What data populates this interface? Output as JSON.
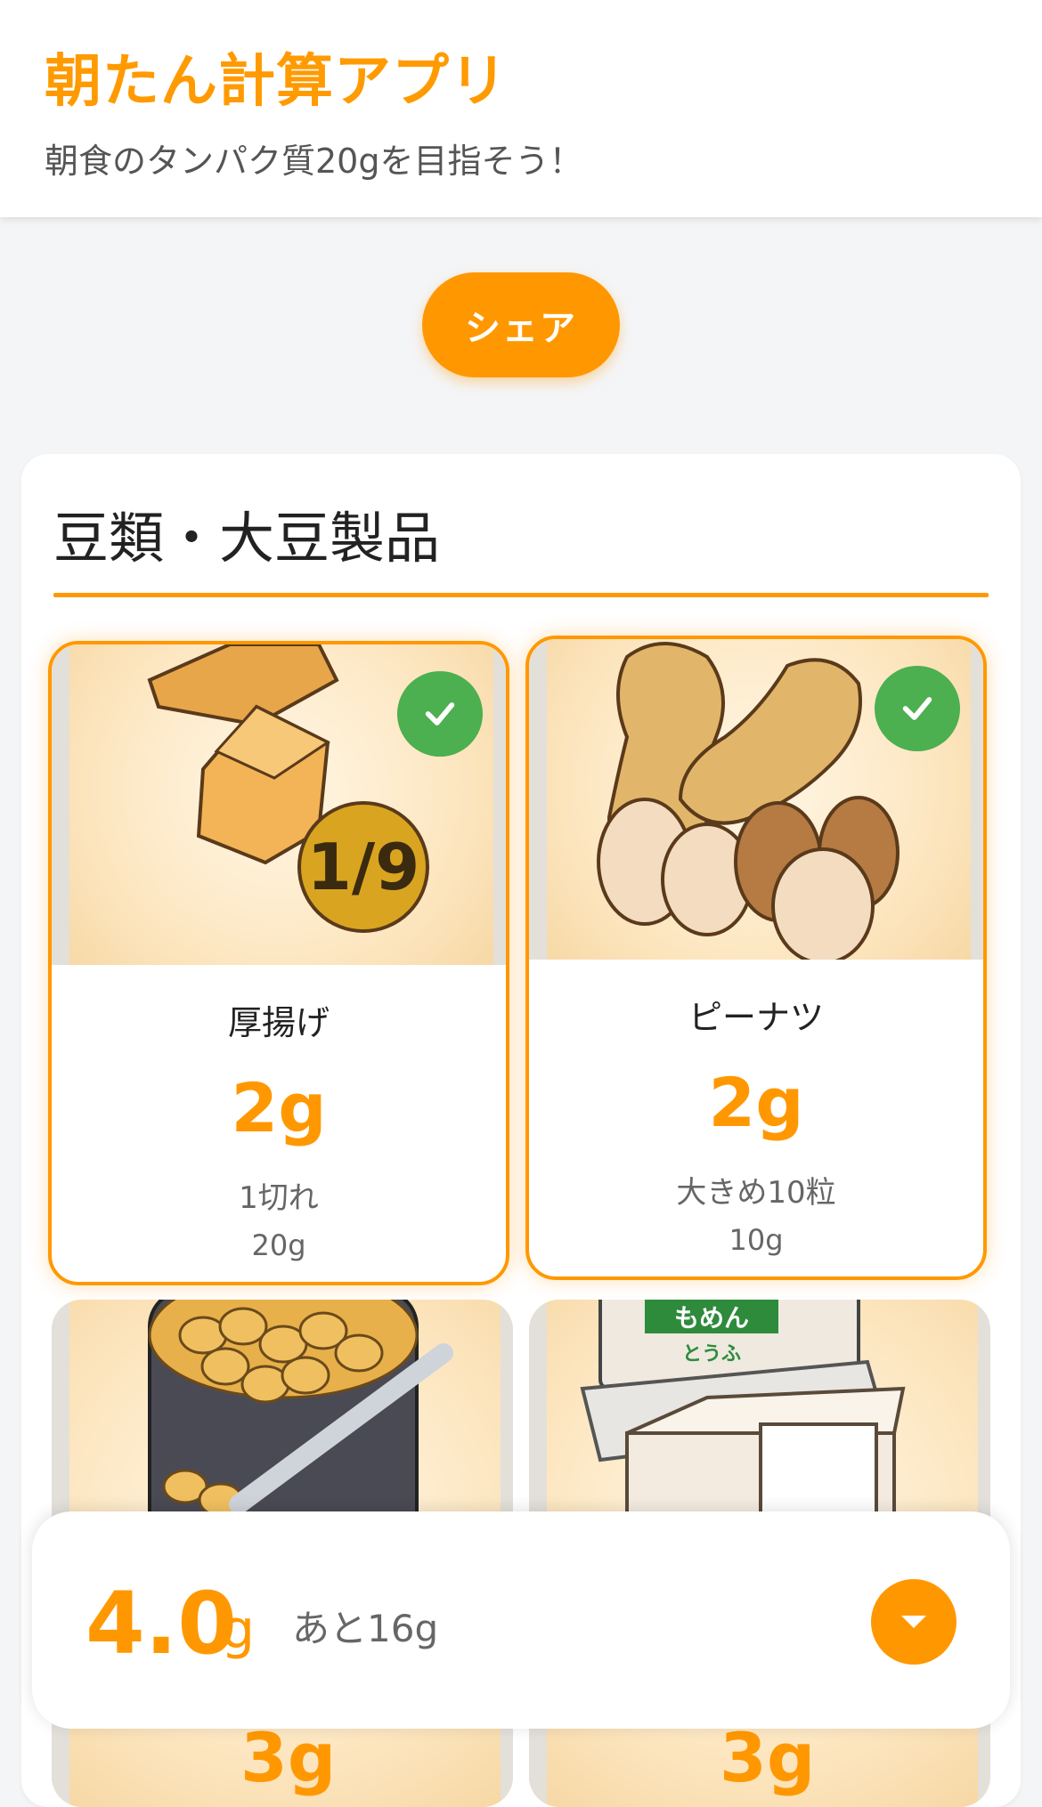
{
  "header": {
    "title": "朝たん計算アプリ",
    "subtitle": "朝食のタンパク質20gを目指そう！"
  },
  "share": {
    "label": "シェア"
  },
  "section": {
    "title": "豆類・大豆製品"
  },
  "foods": [
    {
      "name": "厚揚げ",
      "protein": "2g",
      "portion": "1切れ",
      "weight": "20g",
      "selected": true,
      "badge": "1/9"
    },
    {
      "name": "ピーナツ",
      "protein": "2g",
      "portion": "大きめ10粒",
      "weight": "10g",
      "selected": true
    },
    {
      "protein": "3g",
      "selected": false
    },
    {
      "logo_text_top": "もめん",
      "logo_text_bottom": "とうふ",
      "protein": "3g",
      "selected": false
    }
  ],
  "summary": {
    "total_value": "4.0",
    "unit": "g",
    "remaining": "あと16g"
  },
  "colors": {
    "accent": "#ff9800",
    "check": "#4caf50"
  },
  "icons": {
    "check": "check-icon",
    "toggle": "caret-down-icon"
  }
}
